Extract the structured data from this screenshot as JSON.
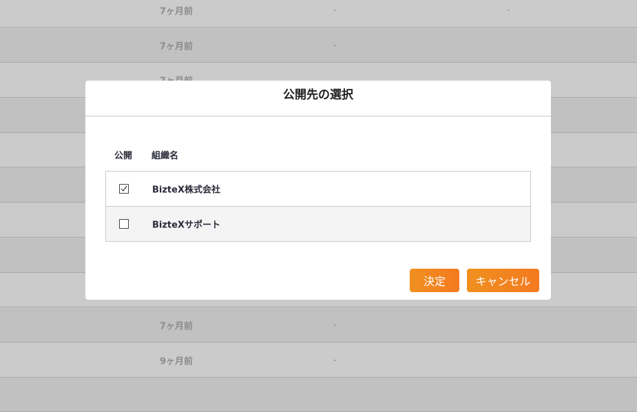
{
  "background_table": {
    "rows": [
      {
        "time": "7ヶ月前",
        "col2": "-",
        "col3": "-"
      },
      {
        "time": "7ヶ月前",
        "col2": "-",
        "col3": ""
      },
      {
        "time": "7ヶ月前",
        "col2": "",
        "col3": ""
      },
      {
        "time": "",
        "col2": "",
        "col3": ""
      },
      {
        "time": "",
        "col2": "",
        "col3": ""
      },
      {
        "time": "",
        "col2": "",
        "col3": ""
      },
      {
        "time": "",
        "col2": "",
        "col3": ""
      },
      {
        "time": "",
        "col2": "",
        "col3": ""
      },
      {
        "time": "",
        "col2": "",
        "col3": ""
      },
      {
        "time": "7ヶ月前",
        "col2": "-",
        "col3": ""
      },
      {
        "time": "9ヶ月前",
        "col2": "-",
        "col3": ""
      }
    ]
  },
  "modal": {
    "title": "公開先の選択",
    "columns": {
      "public": "公開",
      "org_name": "組織名"
    },
    "organizations": [
      {
        "name": "BizteX株式会社",
        "checked": true
      },
      {
        "name": "BizteXサポート",
        "checked": false
      }
    ],
    "buttons": {
      "ok": "決定",
      "cancel": "キャンセル"
    }
  },
  "colors": {
    "overlay": "#c8c8c8",
    "button_gradient_start": "#f0901f",
    "button_gradient_end": "#f47a20"
  }
}
